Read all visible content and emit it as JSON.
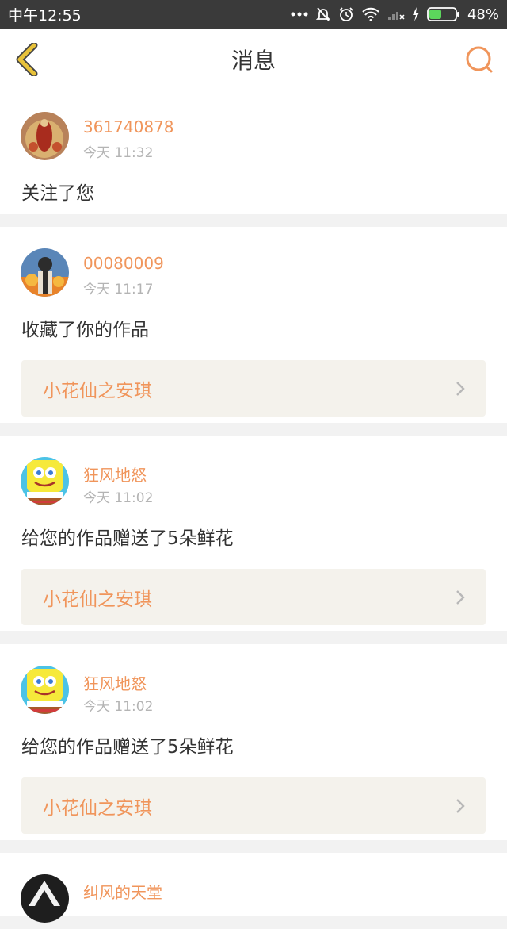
{
  "status_bar": {
    "time": "中午12:55",
    "battery": "48%",
    "battery_level": 0.48
  },
  "nav": {
    "title": "消息",
    "back_icon": "chevron-left-icon",
    "search_icon": "search-icon"
  },
  "colors": {
    "accent": "#f0955b",
    "back_icon": "#e8c23a",
    "card_link_bg": "#f4f2ec"
  },
  "notifications": [
    {
      "username": "361740878",
      "time": "今天 11:32",
      "message": "关注了您"
    },
    {
      "username": "00080009",
      "time": "今天 11:17",
      "message": "收藏了你的作品",
      "work_title": "小花仙之安琪"
    },
    {
      "username": "狂风地怒",
      "time": "今天 11:02",
      "message": "给您的作品赠送了5朵鲜花",
      "work_title": "小花仙之安琪"
    },
    {
      "username": "狂风地怒",
      "time": "今天 11:02",
      "message": "给您的作品赠送了5朵鲜花",
      "work_title": "小花仙之安琪"
    },
    {
      "username": "纠风的天堂",
      "time": "",
      "message": ""
    }
  ]
}
